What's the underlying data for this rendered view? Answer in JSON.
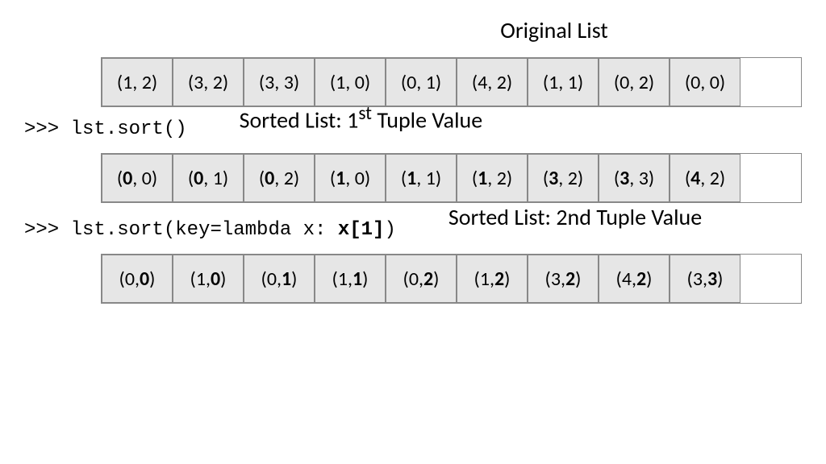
{
  "titles": {
    "original": "Original List",
    "sorted1_html": "Sorted List: 1<sup>st</sup> Tuple Value",
    "sorted2": "Sorted List: 2nd Tuple Value"
  },
  "code": {
    "line1": ">>> lst.sort()",
    "line2_html": ">>> lst.sort(key=lambda x: <b>x[1]</b>)"
  },
  "rows": {
    "original": [
      [
        1,
        2
      ],
      [
        3,
        2
      ],
      [
        3,
        3
      ],
      [
        1,
        0
      ],
      [
        0,
        1
      ],
      [
        4,
        2
      ],
      [
        1,
        1
      ],
      [
        0,
        2
      ],
      [
        0,
        0
      ]
    ],
    "sorted1": [
      [
        0,
        0
      ],
      [
        0,
        1
      ],
      [
        0,
        2
      ],
      [
        1,
        0
      ],
      [
        1,
        1
      ],
      [
        1,
        2
      ],
      [
        3,
        2
      ],
      [
        3,
        3
      ],
      [
        4,
        2
      ]
    ],
    "sorted2": [
      [
        0,
        0
      ],
      [
        1,
        0
      ],
      [
        0,
        1
      ],
      [
        1,
        1
      ],
      [
        0,
        2
      ],
      [
        1,
        2
      ],
      [
        3,
        2
      ],
      [
        4,
        2
      ],
      [
        3,
        3
      ]
    ]
  },
  "bold": {
    "original": null,
    "sorted1": 0,
    "sorted2": 1
  }
}
